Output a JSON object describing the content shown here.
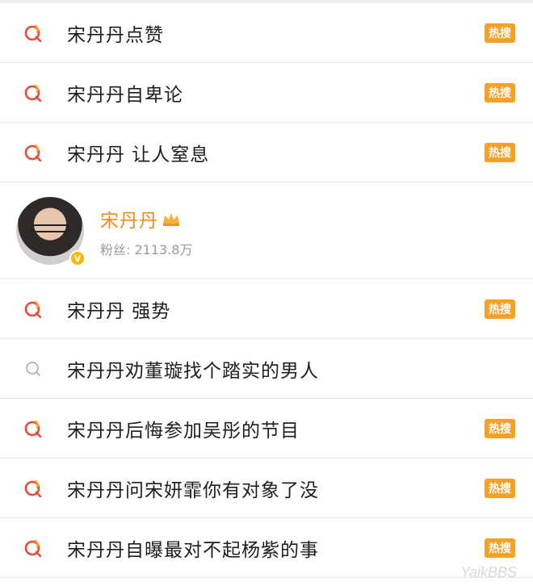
{
  "items_top": [
    {
      "text": "宋丹丹点赞",
      "hot": true,
      "badge": "热搜"
    },
    {
      "text": "宋丹丹自卑论",
      "hot": true,
      "badge": "热搜"
    },
    {
      "text": "宋丹丹 让人窒息",
      "hot": true,
      "badge": "热搜"
    }
  ],
  "profile": {
    "name": "宋丹丹",
    "fans": "粉丝: 2113.8万",
    "verified": "V"
  },
  "items_bottom": [
    {
      "text": "宋丹丹 强势",
      "hot": true,
      "badge": "热搜"
    },
    {
      "text": "宋丹丹劝董璇找个踏实的男人",
      "hot": false,
      "badge": ""
    },
    {
      "text": "宋丹丹后悔参加吴彤的节目",
      "hot": true,
      "badge": "热搜"
    },
    {
      "text": "宋丹丹问宋妍霏你有对象了没",
      "hot": true,
      "badge": "热搜"
    },
    {
      "text": "宋丹丹自曝最对不起杨紫的事",
      "hot": true,
      "badge": "热搜"
    }
  ],
  "watermark": "YaikBBS",
  "colors": {
    "hot_badge": "#f7a026",
    "hot_icon_red": "#e84a3c",
    "hot_icon_orange": "#f5a623",
    "plain_icon": "#b8b8b8",
    "profile_name": "#f18a1a",
    "verified": "#f6b700"
  },
  "icons": {
    "hot_search": "hot-search-icon",
    "search": "search-icon",
    "crown": "crown-icon"
  }
}
